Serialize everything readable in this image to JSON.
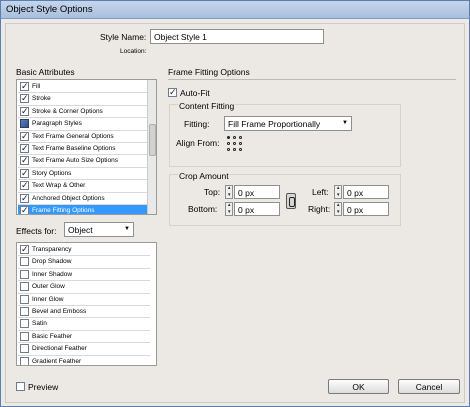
{
  "window": {
    "title": "Object Style Options"
  },
  "style": {
    "name_label": "Style Name:",
    "name_value": "Object Style 1",
    "location_label": "Location:"
  },
  "basic": {
    "heading": "Basic Attributes",
    "items": [
      {
        "label": "Fill",
        "state": "checked"
      },
      {
        "label": "Stroke",
        "state": "checked"
      },
      {
        "label": "Stroke & Corner Options",
        "state": "checked"
      },
      {
        "label": "Paragraph Styles",
        "state": "icon"
      },
      {
        "label": "Text Frame General Options",
        "state": "checked"
      },
      {
        "label": "Text Frame Baseline Options",
        "state": "checked"
      },
      {
        "label": "Text Frame Auto Size Options",
        "state": "checked"
      },
      {
        "label": "Story Options",
        "state": "checked"
      },
      {
        "label": "Text Wrap & Other",
        "state": "checked"
      },
      {
        "label": "Anchored Object Options",
        "state": "checked"
      },
      {
        "label": "Frame Fitting Options",
        "state": "checked",
        "selected": true
      }
    ]
  },
  "effects": {
    "label": "Effects for:",
    "target": "Object",
    "items": [
      {
        "label": "Transparency",
        "state": "checked"
      },
      {
        "label": "Drop Shadow",
        "state": "unchecked"
      },
      {
        "label": "Inner Shadow",
        "state": "unchecked"
      },
      {
        "label": "Outer Glow",
        "state": "unchecked"
      },
      {
        "label": "Inner Glow",
        "state": "unchecked"
      },
      {
        "label": "Bevel and Emboss",
        "state": "unchecked"
      },
      {
        "label": "Satin",
        "state": "unchecked"
      },
      {
        "label": "Basic Feather",
        "state": "unchecked"
      },
      {
        "label": "Directional Feather",
        "state": "unchecked"
      },
      {
        "label": "Gradient Feather",
        "state": "unchecked"
      }
    ]
  },
  "frame_fitting": {
    "heading": "Frame Fitting Options",
    "auto_fit_label": "Auto-Fit",
    "content_fitting_heading": "Content Fitting",
    "fitting_label": "Fitting:",
    "fitting_value": "Fill Frame Proportionally",
    "align_from_label": "Align From:",
    "crop_heading": "Crop Amount",
    "top_label": "Top:",
    "top_value": "0 px",
    "bottom_label": "Bottom:",
    "bottom_value": "0 px",
    "left_label": "Left:",
    "left_value": "0 px",
    "right_label": "Right:",
    "right_value": "0 px"
  },
  "footer": {
    "preview_label": "Preview",
    "ok_label": "OK",
    "cancel_label": "Cancel"
  },
  "icons": {
    "chevron": "▼"
  }
}
